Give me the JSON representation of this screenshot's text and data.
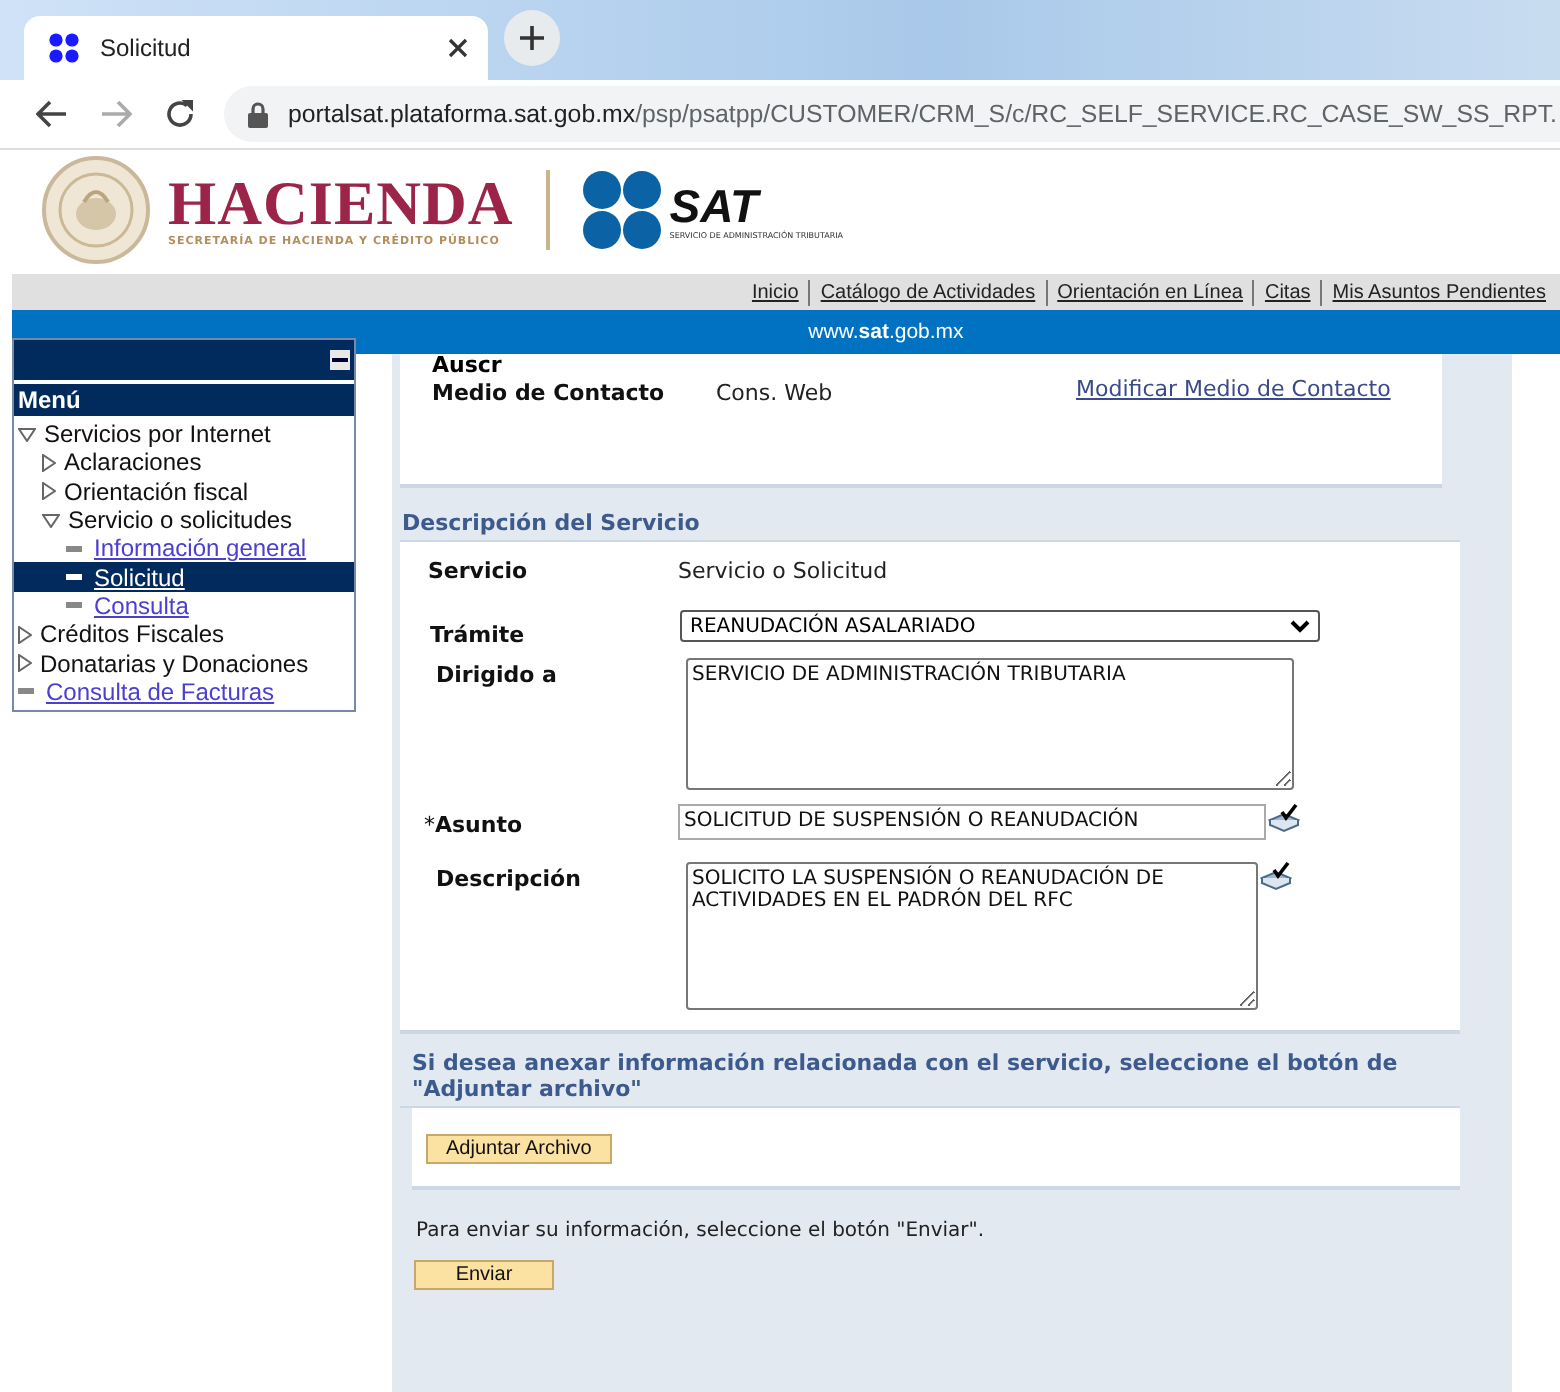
{
  "browser": {
    "tab": {
      "title": "Solicitud",
      "selected": true
    },
    "url": {
      "domain": "portalsat.plataforma.sat.gob.mx",
      "path": "/psp/psatpp/CUSTOMER/CRM_S/c/RC_SELF_SERVICE.RC_CASE_SW_SS_RPT."
    },
    "forward_disabled": true
  },
  "header": {
    "hacienda": {
      "title": "HACIENDA",
      "subtitle": "SECRETARÍA DE HACIENDA Y CRÉDITO PÚBLICO"
    },
    "sat": {
      "title": "SAT",
      "subtitle": "SERVICIO DE ADMINISTRACIÓN TRIBUTARIA"
    }
  },
  "nav_links": [
    "Inicio",
    "Catálogo de Actividades",
    "Orientación en Línea",
    "Citas",
    "Mis Asuntos Pendientes"
  ],
  "site_bar": "www.**sat**.gob.mx",
  "menu": {
    "title": "Menú",
    "items": [
      {
        "kind": "folder",
        "label": "Servicios por Internet",
        "expanded": true,
        "children": [
          {
            "kind": "folder",
            "label": "Aclaraciones",
            "expanded": false
          },
          {
            "kind": "folder",
            "label": "Orientación fiscal",
            "expanded": false
          },
          {
            "kind": "folder",
            "label": "Servicio o solicitudes",
            "expanded": true,
            "children": [
              {
                "kind": "link",
                "label": "Información general",
                "selected": false
              },
              {
                "kind": "link",
                "label": "Solicitud",
                "selected": true
              },
              {
                "kind": "link",
                "label": "Consulta",
                "selected": false
              }
            ]
          }
        ]
      },
      {
        "kind": "folder",
        "label": "Créditos Fiscales",
        "expanded": false
      },
      {
        "kind": "folder",
        "label": "Donatarias y Donaciones",
        "expanded": false
      },
      {
        "kind": "link",
        "label": "Consulta de Facturas",
        "selected": false
      }
    ]
  },
  "contact": {
    "cut_label": "Auscr",
    "label": "Medio de Contacto",
    "value": "Cons. Web",
    "link": "Modificar Medio de Contacto"
  },
  "service": {
    "heading": "Descripción del Servicio",
    "fields": [
      {
        "kind": "text",
        "label": "Servicio",
        "value": "Servicio o Solicitud"
      },
      {
        "kind": "select",
        "label": "Trámite",
        "value": "REANUDACIÓN ASALARIADO"
      },
      {
        "kind": "textarea",
        "label": "Dirigido a",
        "value": "SERVICIO DE ADMINISTRACIÓN TRIBUTARIA"
      },
      {
        "kind": "input",
        "label": "Asunto",
        "required_mark": "*",
        "value": "SOLICITUD DE SUSPENSIÓN O REANUDACIÓN",
        "spellcheck": true
      },
      {
        "kind": "textarea",
        "label": "Descripción",
        "value": "SOLICITO LA SUSPENSIÓN O REANUDACIÓN DE ACTIVIDADES EN EL PADRÓN DEL RFC",
        "spellcheck": true
      }
    ]
  },
  "attach": {
    "heading": "Si desea anexar información relacionada con el servicio, seleccione el botón de \"Adjuntar archivo\"",
    "button": "Adjuntar Archivo"
  },
  "send": {
    "text": "Para enviar su información, seleccione el botón \"Enviar\".",
    "button": "Enviar"
  }
}
